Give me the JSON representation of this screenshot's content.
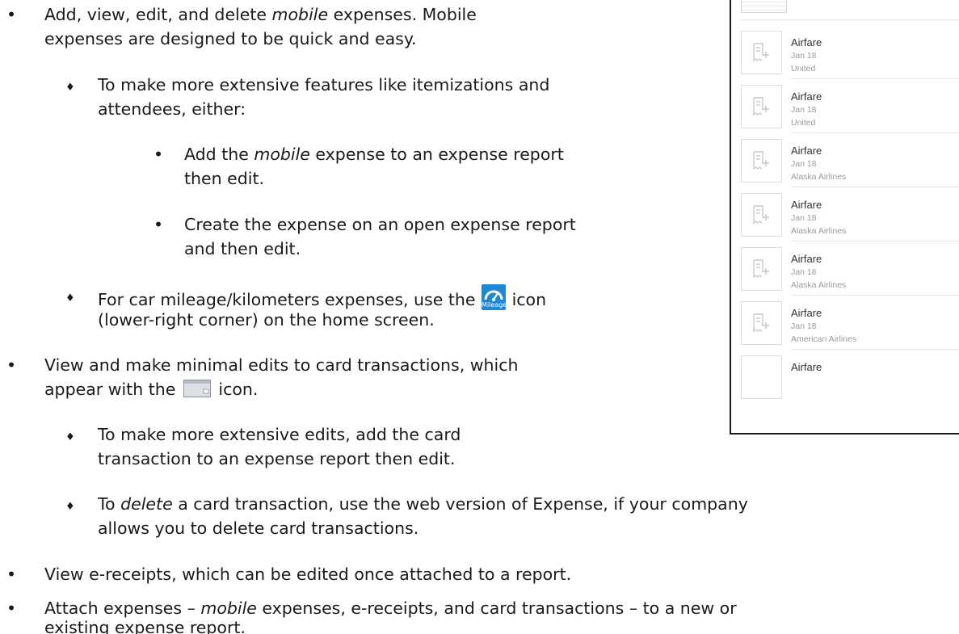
{
  "document": {
    "b1": {
      "t1": "Add, view, edit, and delete ",
      "em": "mobile",
      "t2": " expenses. Mobile",
      "line2": "expenses are designed to be quick and easy."
    },
    "b1a": {
      "line1": "To make more extensive features like itemizations and",
      "line2": "attendees, either:"
    },
    "b1a1": {
      "t1": "Add the ",
      "em": "mobile",
      "t2": " expense to an expense report",
      "line2": "then edit."
    },
    "b1a2": {
      "line1": "Create the expense on an open expense report",
      "line2": "and then edit."
    },
    "b1b": {
      "t1": "For car mileage/kilometers expenses, use the",
      "icon_label": "Mileage",
      "t2": "icon",
      "line2": "(lower-right corner) on the home screen."
    },
    "b2": {
      "line1": "View and make minimal edits to card transactions, which",
      "t1": "appear with the",
      "t2": "icon."
    },
    "b2a": {
      "line1": "To make more extensive edits, add the card",
      "line2": "transaction to an expense report then edit."
    },
    "b2b": {
      "t1": "To ",
      "em": "delete",
      "t2": " a card transaction, use the web version of Expense, if your company",
      "line2": "allows you to delete card transactions."
    },
    "b3": {
      "line1": "View e-receipts, which can be edited once attached to a report."
    },
    "b4": {
      "t1": "Attach expenses – ",
      "em": "mobile",
      "t2": " expenses, e-receipts, and card transactions – to a new or",
      "line2": "existing expense report."
    }
  },
  "phone": {
    "expenses": [
      {
        "title": "Airfare",
        "date": "Jan 18",
        "vendor": "United"
      },
      {
        "title": "Airfare",
        "date": "Jan 18",
        "vendor": "United"
      },
      {
        "title": "Airfare",
        "date": "Jan 18",
        "vendor": "Alaska Airlines"
      },
      {
        "title": "Airfare",
        "date": "Jan 18",
        "vendor": "Alaska Airlines"
      },
      {
        "title": "Airfare",
        "date": "Jan 18",
        "vendor": "Alaska Airlines"
      },
      {
        "title": "Airfare",
        "date": "Jan 18",
        "vendor": "American Airlines"
      },
      {
        "title": "Airfare",
        "date": "",
        "vendor": ""
      }
    ]
  },
  "icons": [
    "mileage-icon",
    "card-icon",
    "receipt-add-icon"
  ],
  "colors": {
    "text": "#1a1a1a",
    "mileage_icon": "#1e88d6",
    "secondary_text": "#9a9a9a"
  }
}
